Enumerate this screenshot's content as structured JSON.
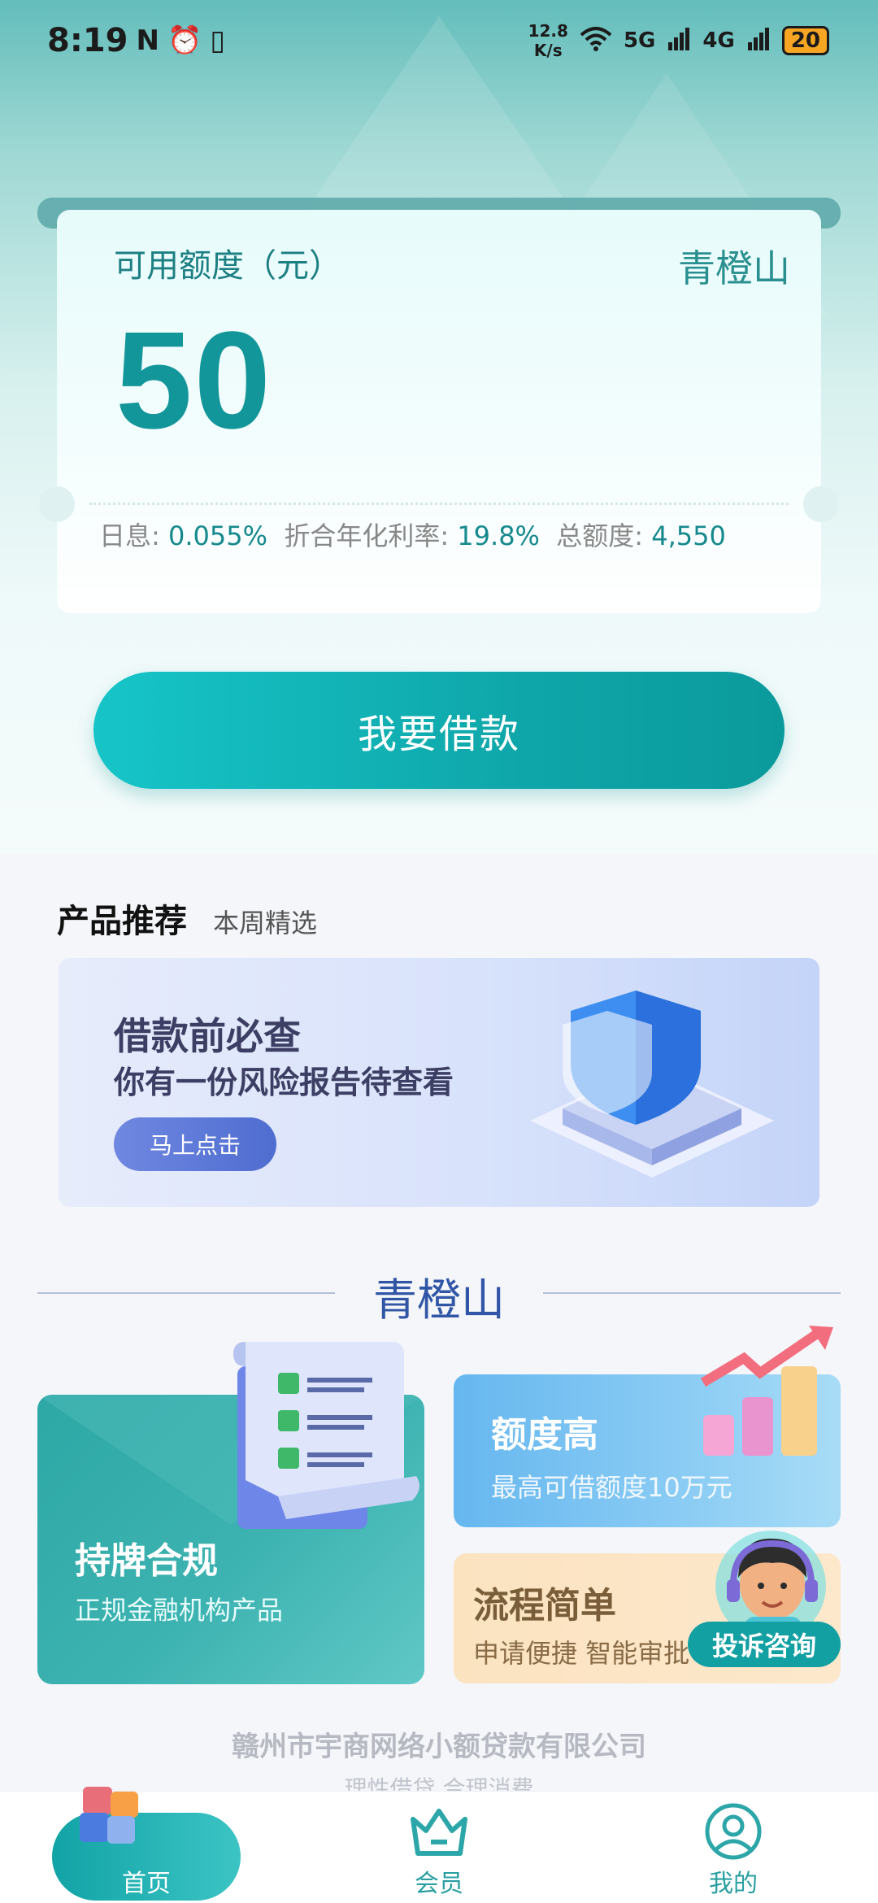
{
  "status_bar": {
    "time": "8:19",
    "net_speed_top": "12.8",
    "net_speed_bottom": "K/s",
    "signal1": "5G",
    "signal2": "4G",
    "battery": "20"
  },
  "credit_card": {
    "label": "可用额度（元）",
    "brand": "青橙山",
    "amount": "50",
    "daily_rate_label": "日息:",
    "daily_rate": "0.055%",
    "annual_rate_label": "折合年化利率:",
    "annual_rate": "19.8%",
    "total_label": "总额度:",
    "total": "4,550"
  },
  "borrow_button": "我要借款",
  "recommend": {
    "title": "产品推荐",
    "subtitle": "本周精选",
    "banner_line1": "借款前必查",
    "banner_line2": "你有一份风险报告待查看",
    "banner_button": "马上点击"
  },
  "section_title": "青橙山",
  "features": {
    "licensed_title": "持牌合规",
    "licensed_sub": "正规金融机构产品",
    "quota_title": "额度高",
    "quota_sub": "最高可借额度10万元",
    "process_title": "流程简单",
    "process_sub": "申请便捷 智能审批"
  },
  "support_button": "投诉咨询",
  "footer": {
    "company": "赣州市宇商网络小额贷款有限公司",
    "slogan": "理性借贷 合理消费"
  },
  "nav": {
    "home": "首页",
    "member": "会员",
    "mine": "我的"
  },
  "colors": {
    "primary": "#13969a",
    "accent_blue": "#3156a6"
  }
}
